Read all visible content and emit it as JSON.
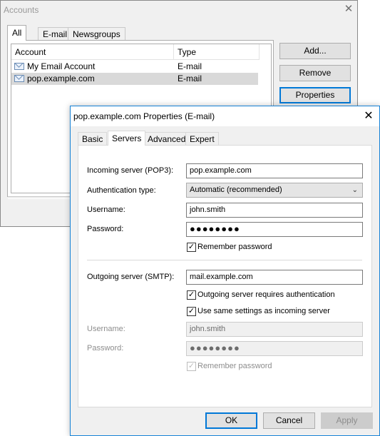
{
  "accounts_window": {
    "title": "Accounts",
    "tabs": [
      "All",
      "E-mail",
      "Newsgroups"
    ],
    "list": {
      "columns": [
        "Account",
        "Type"
      ],
      "rows": [
        {
          "account": "My Email Account",
          "type": "E-mail"
        },
        {
          "account": "pop.example.com",
          "type": "E-mail"
        }
      ]
    },
    "buttons": {
      "add": "Add...",
      "remove": "Remove",
      "properties": "Properties"
    }
  },
  "properties_dialog": {
    "title": "pop.example.com Properties (E-mail)",
    "tabs": [
      "Basic",
      "Servers",
      "Advanced",
      "Expert"
    ],
    "active_tab": "Servers",
    "incoming": {
      "server_label": "Incoming server (POP3):",
      "server_value": "pop.example.com",
      "auth_label": "Authentication type:",
      "auth_value": "Automatic (recommended)",
      "username_label": "Username:",
      "username_value": "john.smith",
      "password_label": "Password:",
      "password_value": "●●●●●●●●",
      "remember_label": "Remember password",
      "remember_checked": true
    },
    "outgoing": {
      "server_label": "Outgoing server (SMTP):",
      "server_value": "mail.example.com",
      "requires_auth_label": "Outgoing server requires authentication",
      "requires_auth_checked": true,
      "same_settings_label": "Use same settings as incoming server",
      "same_settings_checked": true,
      "username_label": "Username:",
      "username_value": "john.smith",
      "password_label": "Password:",
      "password_value": "●●●●●●●●",
      "remember_label": "Remember password",
      "remember_checked": true
    },
    "buttons": {
      "ok": "OK",
      "cancel": "Cancel",
      "apply": "Apply"
    },
    "colors": {
      "accent": "#0078d7",
      "selection": "#d9d9d9",
      "disabled_text": "#8d8d8d"
    }
  }
}
